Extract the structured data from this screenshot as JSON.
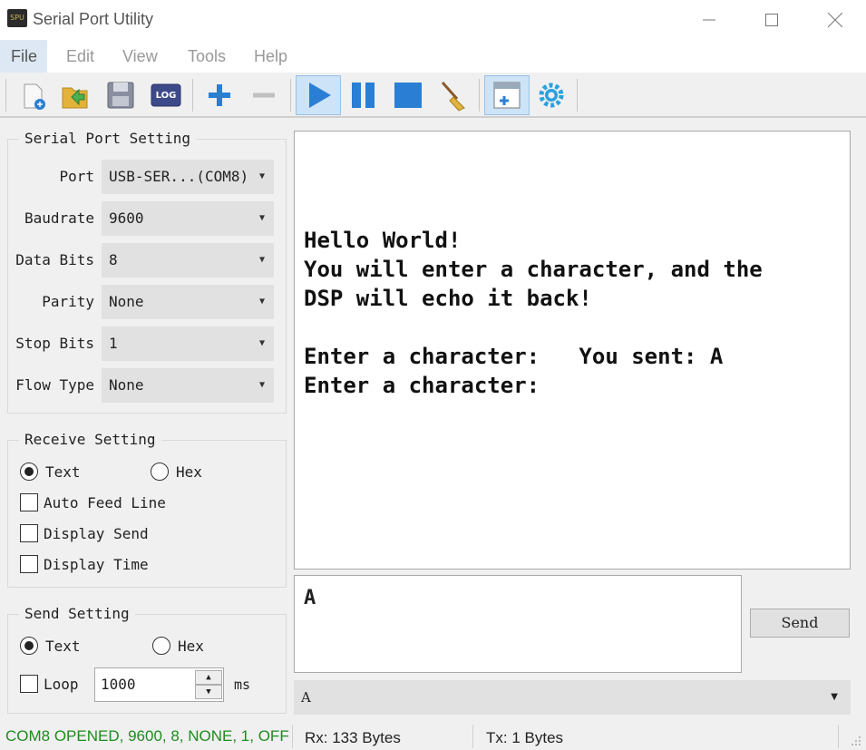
{
  "window": {
    "title": "Serial Port Utility",
    "app_icon_text": "SPU"
  },
  "menu": {
    "items": [
      "File",
      "Edit",
      "View",
      "Tools",
      "Help"
    ]
  },
  "toolbar": {
    "icons": [
      "new-file-icon",
      "open-folder-icon",
      "save-icon",
      "log-icon",
      "add-icon",
      "remove-icon",
      "play-icon",
      "pause-icon",
      "stop-icon",
      "broom-clear-icon",
      "new-window-icon",
      "settings-gear-icon"
    ],
    "log_label": "LOG"
  },
  "serial_port_setting": {
    "title": "Serial Port Setting",
    "fields": [
      {
        "label": "Port",
        "value": "USB-SER...(COM8)"
      },
      {
        "label": "Baudrate",
        "value": "9600"
      },
      {
        "label": "Data Bits",
        "value": "8"
      },
      {
        "label": "Parity",
        "value": "None"
      },
      {
        "label": "Stop Bits",
        "value": "1"
      },
      {
        "label": "Flow Type",
        "value": "None"
      }
    ]
  },
  "receive_setting": {
    "title": "Receive Setting",
    "text_label": "Text",
    "hex_label": "Hex",
    "options": [
      "Auto Feed Line",
      "Display Send",
      "Display Time"
    ]
  },
  "send_setting": {
    "title": "Send Setting",
    "text_label": "Text",
    "hex_label": "Hex",
    "loop_label": "Loop",
    "loop_value": "1000",
    "unit": "ms"
  },
  "receive_area": {
    "lines": [
      "Hello World!",
      "You will enter a character, and the",
      "DSP will echo it back!",
      "",
      "Enter a character:   You sent: A",
      "Enter a character:"
    ]
  },
  "send_area": {
    "value": "A",
    "send_button": "Send",
    "history_value": "A"
  },
  "status": {
    "connection": "COM8 OPENED, 9600, 8, NONE, 1, OFF",
    "rx": "Rx: 133 Bytes",
    "tx": "Tx: 1 Bytes"
  },
  "colors": {
    "status_green": "#1e8c1e",
    "accent_blue": "#2a7fd4"
  }
}
